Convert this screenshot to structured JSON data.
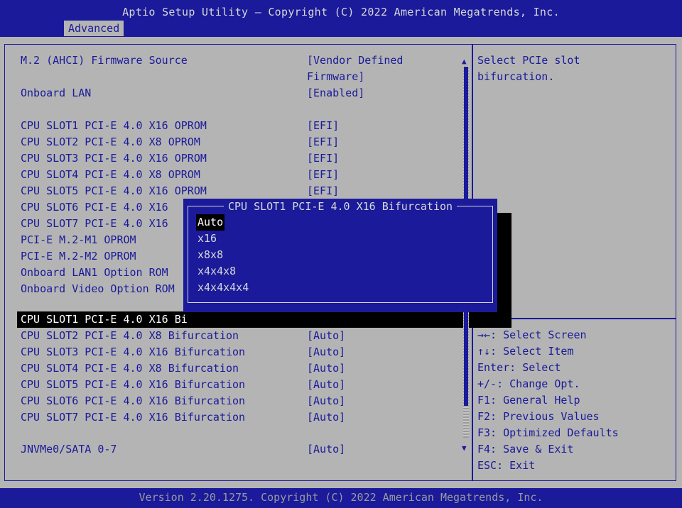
{
  "header": {
    "title": "Aptio Setup Utility – Copyright (C) 2022 American Megatrends, Inc.",
    "tab": "Advanced"
  },
  "settings": [
    {
      "label": "M.2 (AHCI) Firmware Source",
      "value": "[Vendor Defined",
      "value2": "Firmware]"
    },
    {
      "label": "Onboard LAN",
      "value": "[Enabled]"
    },
    {
      "label": "CPU SLOT1 PCI-E 4.0 X16 OPROM",
      "value": "[EFI]"
    },
    {
      "label": "CPU SLOT2 PCI-E 4.0 X8 OPROM",
      "value": "[EFI]"
    },
    {
      "label": "CPU SLOT3 PCI-E 4.0 X16 OPROM",
      "value": "[EFI]"
    },
    {
      "label": "CPU SLOT4 PCI-E 4.0 X8 OPROM",
      "value": "[EFI]"
    },
    {
      "label": "CPU SLOT5 PCI-E 4.0 X16 OPROM",
      "value": "[EFI]"
    },
    {
      "label": "CPU SLOT6 PCI-E 4.0 X16",
      "value": ""
    },
    {
      "label": "CPU SLOT7 PCI-E 4.0 X16",
      "value": ""
    },
    {
      "label": "PCI-E M.2-M1 OPROM",
      "value": ""
    },
    {
      "label": "PCI-E M.2-M2 OPROM",
      "value": ""
    },
    {
      "label": "Onboard LAN1 Option ROM",
      "value": ""
    },
    {
      "label": "Onboard Video Option ROM",
      "value": ""
    },
    {
      "label": "CPU SLOT1 PCI-E 4.0 X16 Bi",
      "value": ""
    },
    {
      "label": "CPU SLOT2 PCI-E 4.0 X8 Bifurcation",
      "value": "[Auto]"
    },
    {
      "label": "CPU SLOT3 PCI-E 4.0 X16 Bifurcation",
      "value": "[Auto]"
    },
    {
      "label": "CPU SLOT4 PCI-E 4.0 X8 Bifurcation",
      "value": "[Auto]"
    },
    {
      "label": "CPU SLOT5 PCI-E 4.0 X16 Bifurcation",
      "value": "[Auto]"
    },
    {
      "label": "CPU SLOT6 PCI-E 4.0 X16 Bifurcation",
      "value": "[Auto]"
    },
    {
      "label": "CPU SLOT7 PCI-E 4.0 X16 Bifurcation",
      "value": "[Auto]"
    },
    {
      "label": "JNVMe0/SATA 0-7",
      "value": "[Auto]"
    }
  ],
  "help": {
    "line1": "Select PCIe slot",
    "line2": "bifurcation."
  },
  "keys": [
    "→←: Select Screen",
    "↑↓: Select Item",
    "Enter: Select",
    "+/-: Change Opt.",
    "F1: General Help",
    "F2: Previous Values",
    "F3: Optimized Defaults",
    "F4: Save & Exit",
    "ESC: Exit"
  ],
  "scrollbar": {
    "up": "▲",
    "down": "▼"
  },
  "popup": {
    "title": "CPU SLOT1 PCI-E 4.0 X16 Bifurcation",
    "options": [
      "Auto",
      "x16",
      "x8x8",
      "x4x4x8",
      "x4x4x4x4"
    ]
  },
  "footer": {
    "version": "Version 2.20.1275. Copyright (C) 2022 American Megatrends, Inc."
  }
}
